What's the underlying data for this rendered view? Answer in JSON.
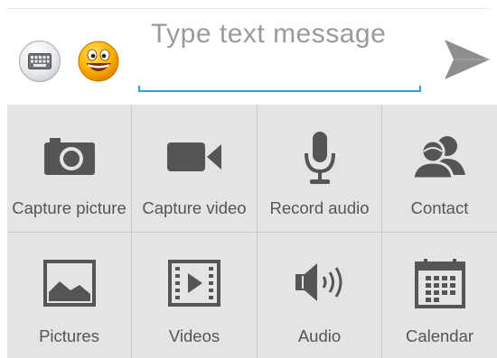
{
  "compose": {
    "placeholder": "Type text message",
    "keyboard_button": "keyboard-icon",
    "emoji_button": "smiley-icon",
    "send_button": "send-icon",
    "accent_color": "#33a0c8"
  },
  "attachments": {
    "items": [
      {
        "label": "Capture picture",
        "icon": "camera-icon"
      },
      {
        "label": "Capture video",
        "icon": "video-camera-icon"
      },
      {
        "label": "Record audio",
        "icon": "microphone-icon"
      },
      {
        "label": "Contact",
        "icon": "contact-icon"
      },
      {
        "label": "Pictures",
        "icon": "picture-icon"
      },
      {
        "label": "Videos",
        "icon": "film-icon"
      },
      {
        "label": "Audio",
        "icon": "speaker-icon"
      },
      {
        "label": "Calendar",
        "icon": "calendar-icon"
      }
    ]
  }
}
